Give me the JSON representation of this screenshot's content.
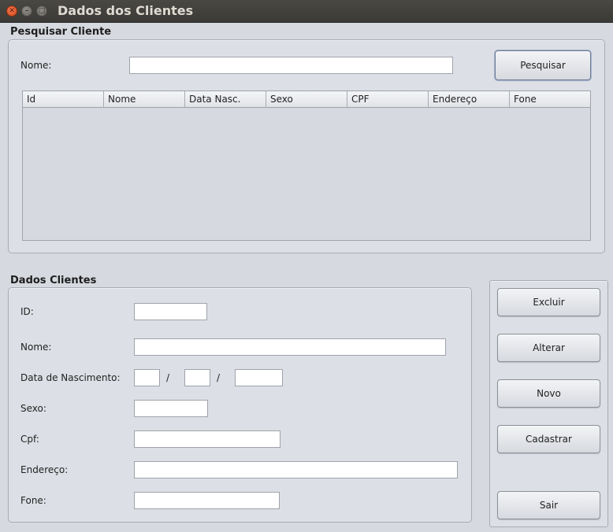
{
  "window": {
    "title": "Dados dos Clientes"
  },
  "search": {
    "section_title": "Pesquisar Cliente",
    "name_label": "Nome:",
    "name_value": "",
    "button_label": "Pesquisar",
    "columns": [
      "Id",
      "Nome",
      "Data Nasc.",
      "Sexo",
      "CPF",
      "Endereço",
      "Fone"
    ],
    "rows": []
  },
  "form": {
    "section_title": "Dados Clientes",
    "id_label": "ID:",
    "nome_label": "Nome:",
    "nasc_label": "Data de Nascimento:",
    "date_sep": "/",
    "sexo_label": "Sexo:",
    "cpf_label": "Cpf:",
    "endereco_label": "Endereço:",
    "fone_label": "Fone:"
  },
  "actions": {
    "excluir": "Excluir",
    "alterar": "Alterar",
    "novo": "Novo",
    "cadastrar": "Cadastrar",
    "sair": "Sair"
  }
}
